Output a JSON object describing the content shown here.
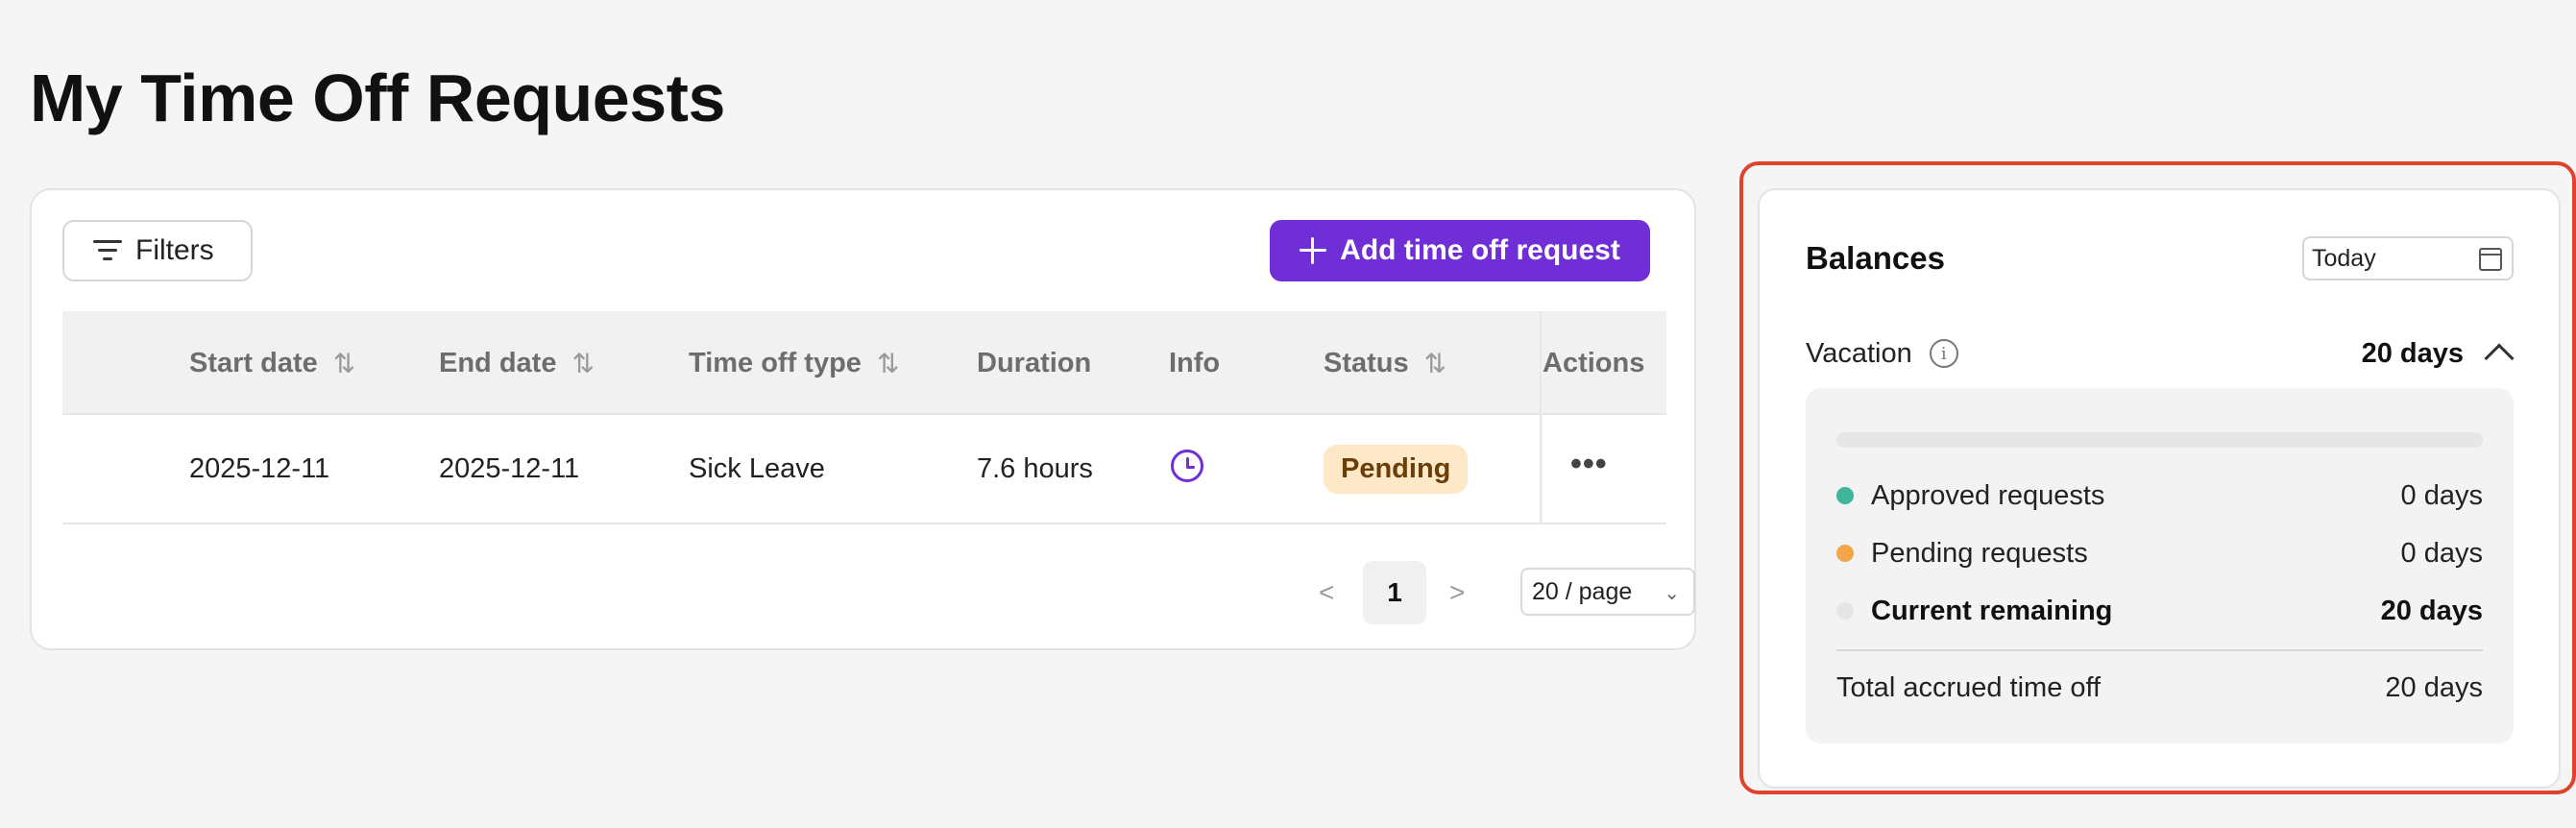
{
  "page": {
    "title": "My Time Off Requests"
  },
  "toolbar": {
    "filters_label": "Filters",
    "add_label": "Add time off request"
  },
  "table": {
    "columns": [
      {
        "label": "Start date",
        "sortable": true
      },
      {
        "label": "End date",
        "sortable": true
      },
      {
        "label": "Time off type",
        "sortable": true
      },
      {
        "label": "Duration",
        "sortable": false
      },
      {
        "label": "Info",
        "sortable": false
      },
      {
        "label": "Status",
        "sortable": true
      },
      {
        "label": "Actions",
        "sortable": false
      }
    ],
    "sort_glyph": "⇅",
    "rows": [
      {
        "start_date": "2025-12-11",
        "end_date": "2025-12-11",
        "type": "Sick Leave",
        "duration": "7.6 hours",
        "info_icon": "clock-icon",
        "status": "Pending",
        "actions_icon": "more-icon"
      }
    ]
  },
  "pagination": {
    "prev": "<",
    "current": "1",
    "next": ">",
    "page_size": "20 / page"
  },
  "balances": {
    "title": "Balances",
    "date_value": "Today",
    "vacation": {
      "label": "Vacation",
      "total": "20 days",
      "progress_fraction": 0,
      "breakdown": [
        {
          "label": "Approved requests",
          "value": "0 days",
          "color": "#3fb59a",
          "bold": false
        },
        {
          "label": "Pending requests",
          "value": "0 days",
          "color": "#f3a54a",
          "bold": false
        },
        {
          "label": "Current remaining",
          "value": "20 days",
          "color": "#e5e5e5",
          "bold": true
        }
      ],
      "total_accrued_label": "Total accrued time off",
      "total_accrued_value": "20 days"
    }
  },
  "colors": {
    "accent": "#6f2ed6",
    "highlight": "#e0432c",
    "pending_badge_bg": "#fde8c8"
  }
}
